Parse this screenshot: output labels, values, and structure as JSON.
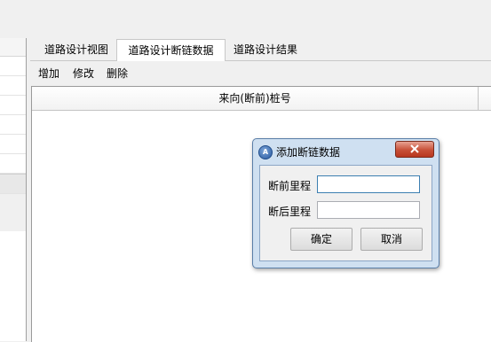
{
  "tabs": [
    {
      "label": "道路设计视图"
    },
    {
      "label": "道路设计断链数据"
    },
    {
      "label": "道路设计结果"
    }
  ],
  "active_tab": "道路设计断链数据",
  "toolbar": {
    "add_label": "增加",
    "edit_label": "修改",
    "delete_label": "删除"
  },
  "grid": {
    "columns": [
      "来向(断前)桩号"
    ]
  },
  "dialog": {
    "title": "添加断链数据",
    "icon": "app-icon",
    "fields": [
      {
        "label": "断前里程",
        "value": ""
      },
      {
        "label": "断后里程",
        "value": ""
      }
    ],
    "ok_label": "确定",
    "cancel_label": "取消"
  }
}
